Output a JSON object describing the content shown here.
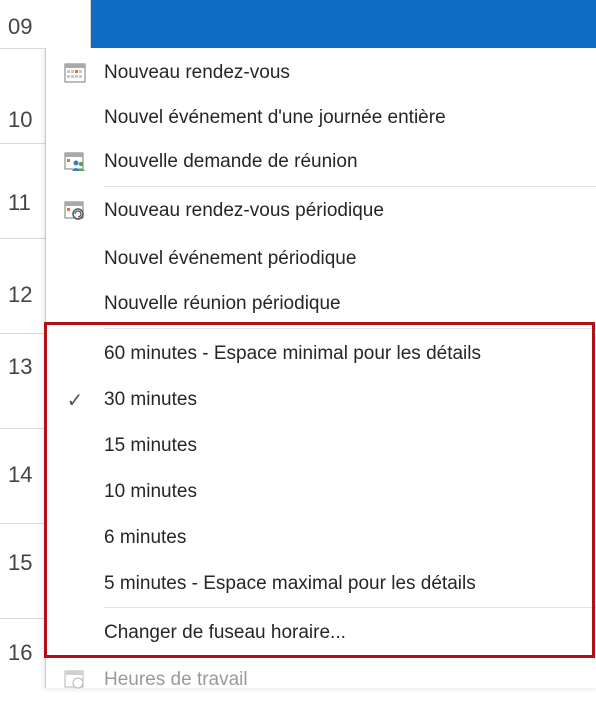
{
  "calendar": {
    "hours": [
      "09",
      "10",
      "11",
      "12",
      "13",
      "14",
      "15",
      "16"
    ]
  },
  "menu": {
    "items": [
      {
        "label": "Nouveau rendez-vous",
        "icon": "new-appointment-icon"
      },
      {
        "label": "Nouvel événement d'une journée entière",
        "icon": ""
      },
      {
        "label": "Nouvelle demande de réunion",
        "icon": "meeting-request-icon"
      },
      {
        "label": "Nouveau rendez-vous périodique",
        "icon": "recurring-appointment-icon"
      },
      {
        "label": "Nouvel événement périodique",
        "icon": ""
      },
      {
        "label": "Nouvelle réunion périodique",
        "icon": ""
      },
      {
        "label": "60 minutes - Espace minimal pour les détails",
        "icon": ""
      },
      {
        "label": "30 minutes",
        "icon": "checkmark-icon",
        "checked": true
      },
      {
        "label": "15 minutes",
        "icon": ""
      },
      {
        "label": "10 minutes",
        "icon": ""
      },
      {
        "label": "6 minutes",
        "icon": ""
      },
      {
        "label": "5 minutes - Espace maximal pour les détails",
        "icon": ""
      },
      {
        "label": "Changer de fuseau horaire...",
        "icon": ""
      },
      {
        "label": "Heures de travail",
        "icon": "work-hours-icon",
        "disabled": true
      }
    ]
  },
  "colors": {
    "selection": "#0f6cc4",
    "highlight_box": "#b01016"
  }
}
